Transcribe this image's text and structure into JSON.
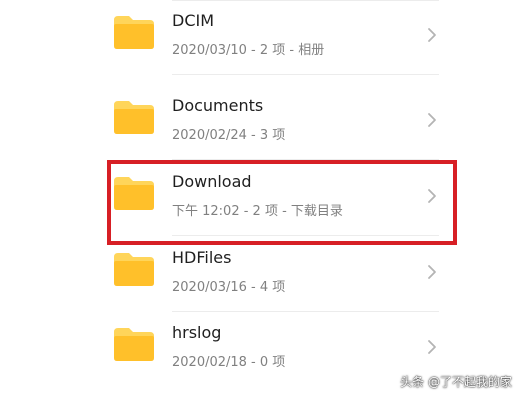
{
  "colors": {
    "folder_yellow": "#FFC02A",
    "folder_tab_yellow": "#FFD55A",
    "highlight_red": "#D71F25",
    "chevron_gray": "#B4B4B4"
  },
  "folders": [
    {
      "name": "DCIM",
      "meta": "2020/03/10 - 2 项 - 相册",
      "icon": "folder-icon",
      "trailing_icon": "chevron-right-icon"
    },
    {
      "name": "Documents",
      "meta": "2020/02/24 - 3 项",
      "icon": "folder-icon",
      "trailing_icon": "chevron-right-icon"
    },
    {
      "name": "Download",
      "meta": "下午 12:02  - 2 项 - 下载目录",
      "icon": "folder-icon",
      "trailing_icon": "chevron-right-icon",
      "highlighted": true
    },
    {
      "name": "HDFiles",
      "meta": "2020/03/16 - 4 项",
      "icon": "folder-icon",
      "trailing_icon": "chevron-right-icon"
    },
    {
      "name": "hrslog",
      "meta": "2020/02/18 - 0 项",
      "icon": "folder-icon",
      "trailing_icon": "chevron-right-icon"
    }
  ],
  "watermark": "头条 @了不起我的家"
}
